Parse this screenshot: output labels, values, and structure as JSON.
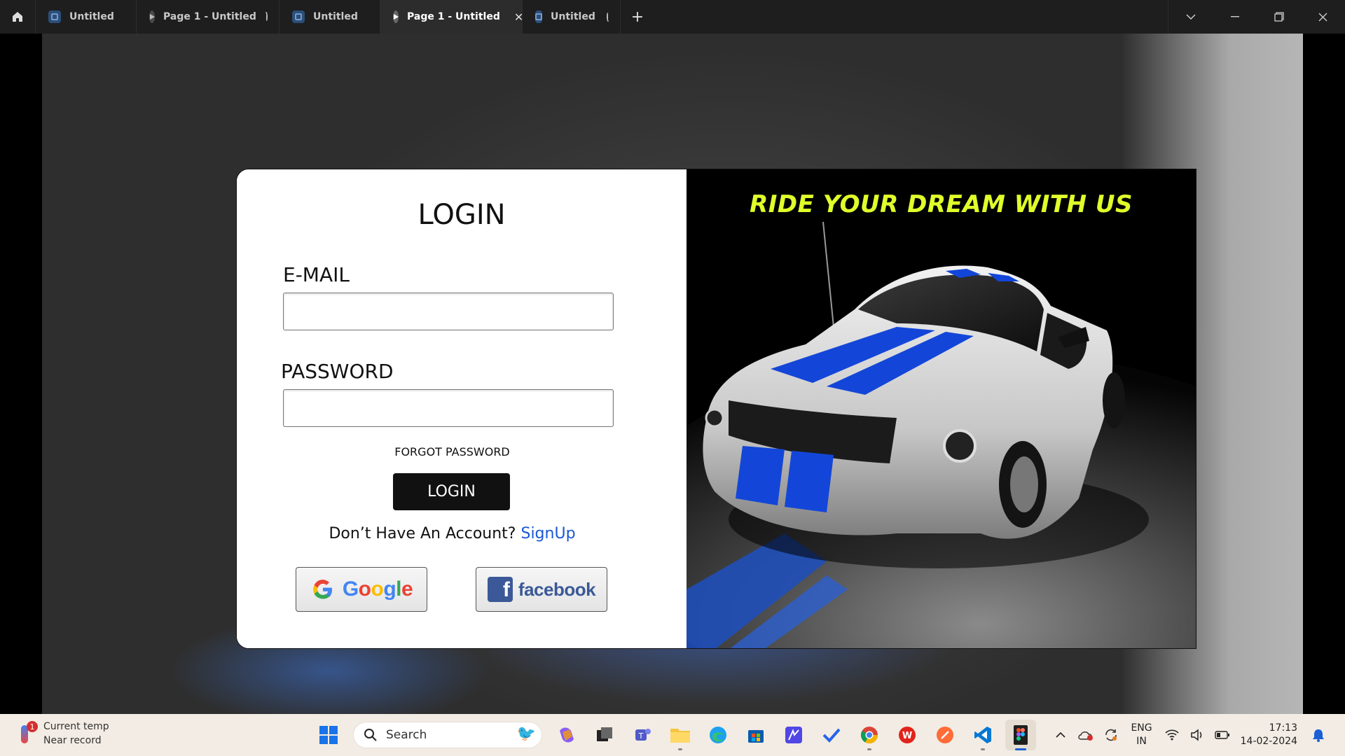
{
  "titlebar": {
    "tabs": [
      {
        "label": "Untitled",
        "icon": "figma-file-icon"
      },
      {
        "label": "Page 1 - Untitled",
        "icon": "play-icon"
      },
      {
        "label": "Untitled",
        "icon": "figma-file-icon"
      },
      {
        "label": "Page 1 - Untitled",
        "icon": "play-icon",
        "active": true
      },
      {
        "label": "Untitled",
        "icon": "figma-file-icon"
      }
    ],
    "new_tab": "+",
    "close_tab": "✕"
  },
  "login_card": {
    "title": "LOGIN",
    "email_label": "E-MAIL",
    "email_value": "",
    "password_label": "PASSWORD",
    "password_value": "",
    "forgot_password": "FORGOT PASSWORD",
    "login_button": "LOGIN",
    "no_account_text": "Don’t Have An Account?",
    "signup_link": "SignUp",
    "google_button": "Google",
    "facebook_button": "facebook",
    "facebook_letter": "f"
  },
  "hero": {
    "tagline": "RIDE YOUR DREAM WITH US",
    "tagline_color": "#e0ff2a"
  },
  "taskbar": {
    "weather_badge": "1",
    "weather_line1": "Current temp",
    "weather_line2": "Near record",
    "search_placeholder": "Search",
    "language_line1": "ENG",
    "language_line2": "IN",
    "time": "17:13",
    "date": "14-02-2024"
  },
  "colors": {
    "accent_link": "#1a57d6",
    "facebook_blue": "#3b5998",
    "button_black": "#111111"
  }
}
